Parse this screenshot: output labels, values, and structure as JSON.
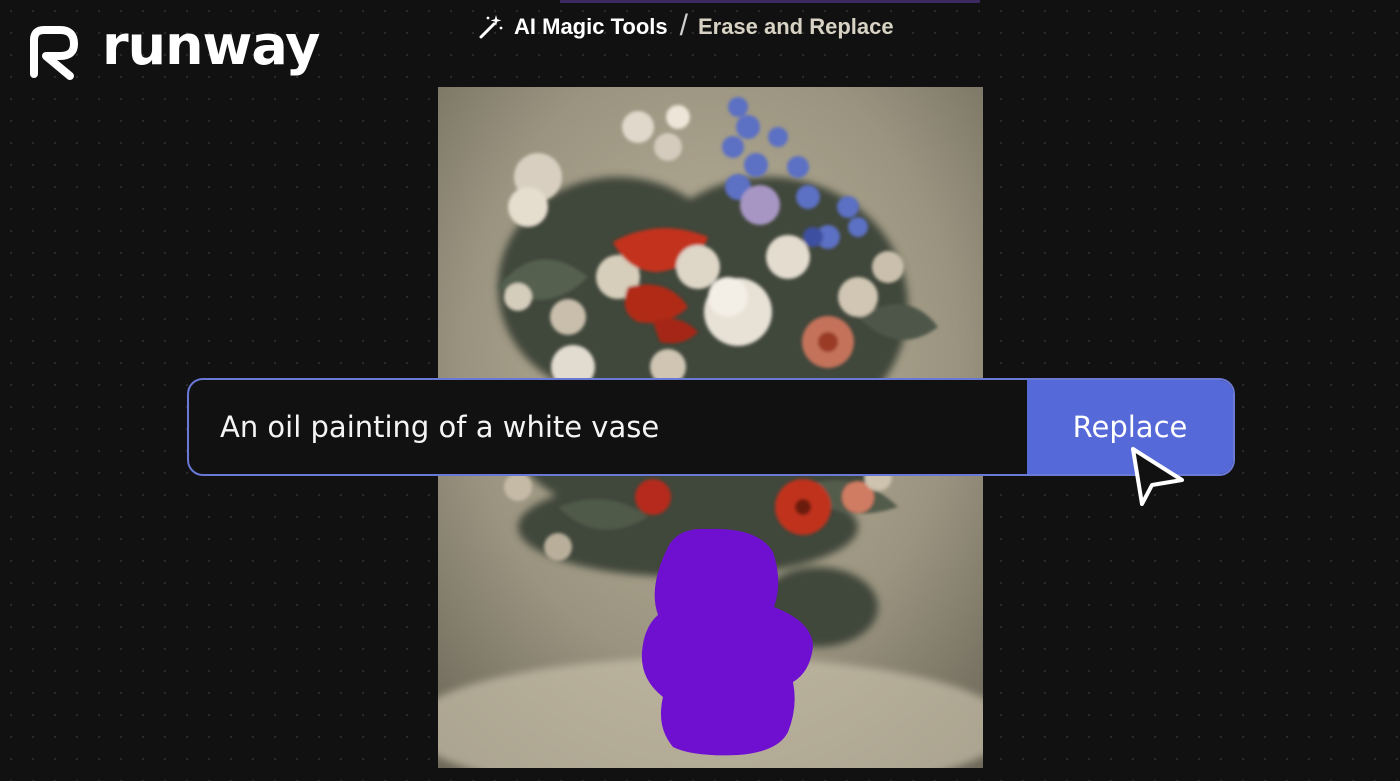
{
  "brand": {
    "name": "runway",
    "logo_icon": "runway-r-logo-icon"
  },
  "breadcrumb": {
    "icon": "magic-wand-icon",
    "items": [
      "AI Magic Tools",
      "Erase and Replace"
    ],
    "separator": "/"
  },
  "prompt": {
    "value": "An oil painting of a white vase",
    "button_label": "Replace"
  },
  "canvas": {
    "mask_color": "#6f10d0",
    "accent_color": "#5669d8"
  },
  "cursor": {
    "icon": "arrow-cursor-icon"
  }
}
